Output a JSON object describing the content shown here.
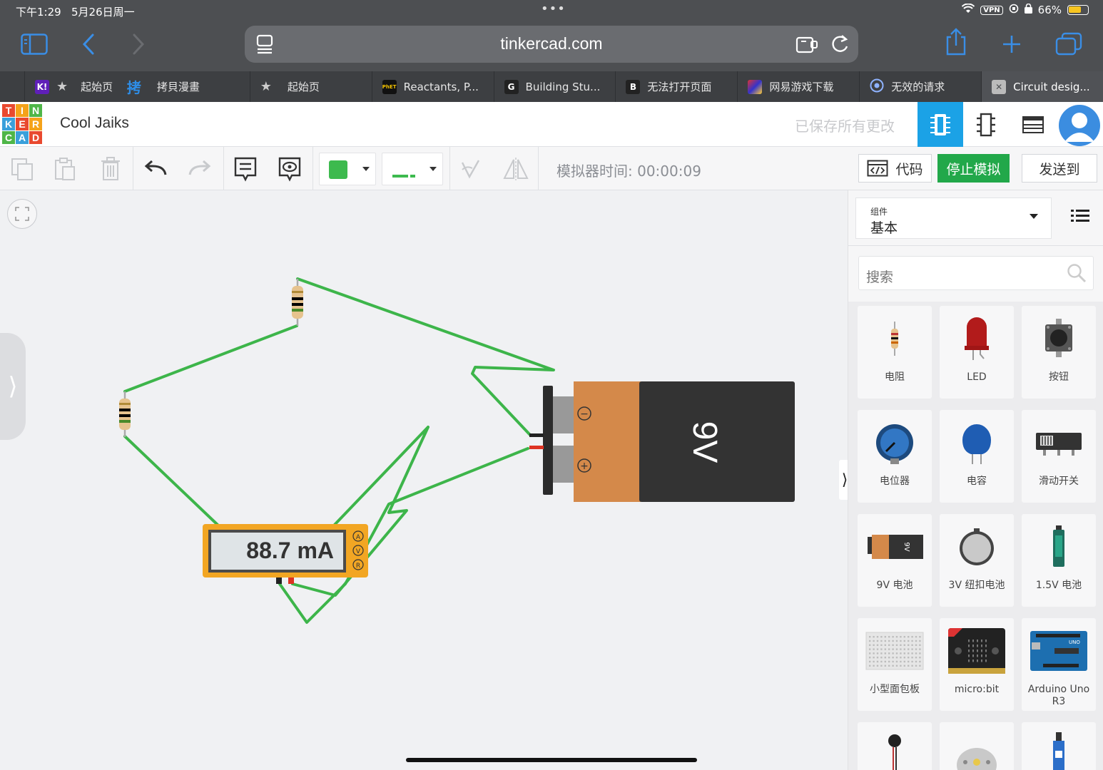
{
  "status": {
    "time": "下午1:29",
    "date": "5月26日周一",
    "battery": "66%",
    "battery_level": 0.66,
    "vpn": "VPN"
  },
  "browser": {
    "url": "tinkercad.com"
  },
  "tabs": [
    {
      "label": "起始页",
      "favicon": "K!",
      "color": "#5f1fb8"
    },
    {
      "label": "起始页",
      "favicon": "star-icon",
      "color": ""
    },
    {
      "label": "拷貝漫畫",
      "favicon": "拷",
      "color": ""
    },
    {
      "label": "起始页",
      "favicon": "star-icon",
      "color": ""
    },
    {
      "label": "Reactants, P...",
      "favicon": "PhET",
      "color": "#111"
    },
    {
      "label": "Building Stu...",
      "favicon": "G",
      "color": "#222"
    },
    {
      "label": "无法打开页面",
      "favicon": "B",
      "color": "#222"
    },
    {
      "label": "网易游戏下载",
      "favicon": "netease-icon",
      "color": ""
    },
    {
      "label": "无效的请求",
      "favicon": "globe-icon",
      "color": ""
    },
    {
      "label": "Circuit desig...",
      "favicon": "close-icon",
      "color": ""
    }
  ],
  "app": {
    "logo": [
      "T",
      "I",
      "N",
      "K",
      "E",
      "R",
      "C",
      "A",
      "D"
    ],
    "project_name": "Cool Jaiks",
    "saved_status": "已保存所有更改"
  },
  "toolbar": {
    "sim_time": "模拟器时间: 00:00:09",
    "code_label": "代码",
    "stop_label": "停止模拟",
    "send_label": "发送到",
    "color_swatch": "#3dba4e"
  },
  "canvas": {
    "meter_reading": "88.7 mA",
    "meter_modes": [
      "A",
      "V",
      "R"
    ],
    "battery_label": "9V",
    "battery_terminals": [
      "−",
      "+"
    ]
  },
  "panel": {
    "components_label": "组件",
    "components_value": "基本",
    "search_placeholder": "搜索",
    "items": [
      {
        "label": "电阻",
        "icon": "resistor-icon"
      },
      {
        "label": "LED",
        "icon": "led-icon"
      },
      {
        "label": "按钮",
        "icon": "pushbutton-icon"
      },
      {
        "label": "电位器",
        "icon": "potentiometer-icon"
      },
      {
        "label": "电容",
        "icon": "capacitor-icon"
      },
      {
        "label": "滑动开关",
        "icon": "slide-switch-icon"
      },
      {
        "label": "9V 电池",
        "icon": "battery-9v-icon"
      },
      {
        "label": "3V 纽扣电池",
        "icon": "coin-cell-icon"
      },
      {
        "label": "1.5V 电池",
        "icon": "battery-aa-icon"
      },
      {
        "label": "小型面包板",
        "icon": "breadboard-icon"
      },
      {
        "label": "micro:bit",
        "icon": "microbit-icon"
      },
      {
        "label": "Arduino Uno R3",
        "icon": "arduino-icon"
      }
    ]
  },
  "colors": {
    "accent": "#1ba2e6",
    "stop": "#22a84a",
    "wire": "#3db54a",
    "battery_orange": "#d4894a",
    "meter": "#f2a623"
  }
}
